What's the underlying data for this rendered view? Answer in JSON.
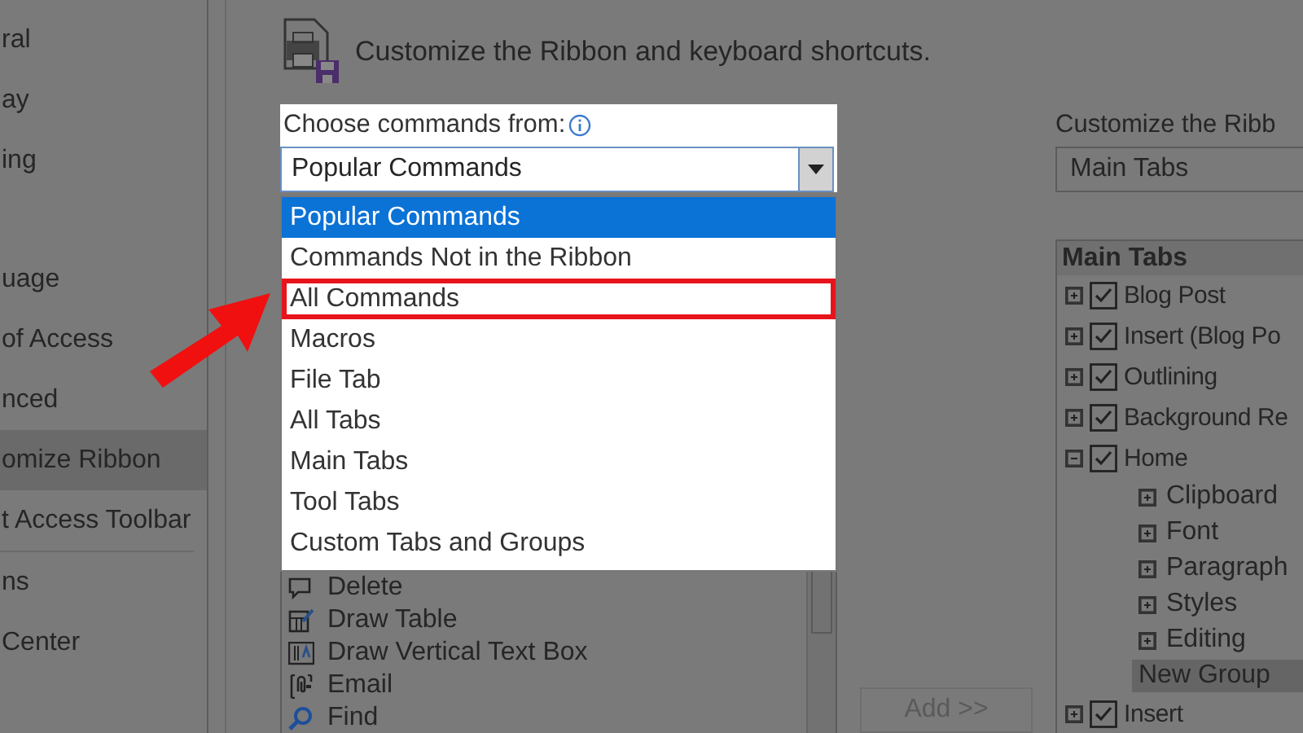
{
  "sidebar": {
    "items": [
      {
        "kind": "item",
        "label": "ral",
        "selected": false
      },
      {
        "kind": "item",
        "label": "ay",
        "selected": false
      },
      {
        "kind": "item",
        "label": "ing",
        "selected": false
      },
      {
        "kind": "spacer"
      },
      {
        "kind": "item",
        "label": "uage",
        "selected": false
      },
      {
        "kind": "item",
        "label": "of Access",
        "selected": false
      },
      {
        "kind": "item",
        "label": "nced",
        "selected": false
      },
      {
        "kind": "item",
        "label": "omize Ribbon",
        "selected": true
      },
      {
        "kind": "item",
        "label": "t Access Toolbar",
        "selected": false
      },
      {
        "kind": "divider"
      },
      {
        "kind": "item",
        "label": "ns",
        "selected": false
      },
      {
        "kind": "item",
        "label": "Center",
        "selected": false
      }
    ]
  },
  "heading": "Customize the Ribbon and keyboard shortcuts.",
  "commands": {
    "label": "Choose commands from:",
    "value": "Popular Commands",
    "options": [
      {
        "label": "Popular Commands",
        "selected": true,
        "marked": false
      },
      {
        "label": "Commands Not in the Ribbon",
        "selected": false,
        "marked": false
      },
      {
        "label": "All Commands",
        "selected": false,
        "marked": true
      },
      {
        "label": "Macros",
        "selected": false,
        "marked": false
      },
      {
        "label": "File Tab",
        "selected": false,
        "marked": false
      },
      {
        "label": "All Tabs",
        "selected": false,
        "marked": false
      },
      {
        "label": "Main Tabs",
        "selected": false,
        "marked": false
      },
      {
        "label": "Tool Tabs",
        "selected": false,
        "marked": false
      },
      {
        "label": "Custom Tabs and Groups",
        "selected": false,
        "marked": false
      }
    ],
    "list": [
      {
        "label": "Delete",
        "kind": "comment"
      },
      {
        "label": "Draw Table",
        "kind": "table"
      },
      {
        "label": "Draw Vertical Text Box",
        "kind": "textbox"
      },
      {
        "label": "Email",
        "kind": "mail"
      },
      {
        "label": "Find",
        "kind": "search"
      }
    ]
  },
  "add_button": {
    "label": "Add >>",
    "disabled": true
  },
  "ribbon": {
    "label": "Customize the Ribb",
    "value": "Main Tabs",
    "tree_heading": "Main Tabs",
    "tree": [
      {
        "label": "Blog Post",
        "checked": true,
        "expanded": false,
        "selected": false
      },
      {
        "label": "Insert (Blog Po",
        "checked": true,
        "expanded": false,
        "selected": false
      },
      {
        "label": "Outlining",
        "checked": true,
        "expanded": false,
        "selected": false
      },
      {
        "label": "Background Re",
        "checked": true,
        "expanded": false,
        "selected": false
      },
      {
        "label": "Home",
        "checked": true,
        "expanded": true,
        "selected": false,
        "children": [
          {
            "label": "Clipboard",
            "kind": "group",
            "selected": false
          },
          {
            "label": "Font",
            "kind": "group",
            "selected": false
          },
          {
            "label": "Paragraph",
            "kind": "group",
            "selected": false
          },
          {
            "label": "Styles",
            "kind": "group",
            "selected": false
          },
          {
            "label": "Editing",
            "kind": "group",
            "selected": false
          },
          {
            "label": "New Group",
            "kind": "new",
            "selected": true
          }
        ]
      },
      {
        "label": "Insert",
        "checked": true,
        "expanded": false,
        "selected": false
      }
    ]
  }
}
